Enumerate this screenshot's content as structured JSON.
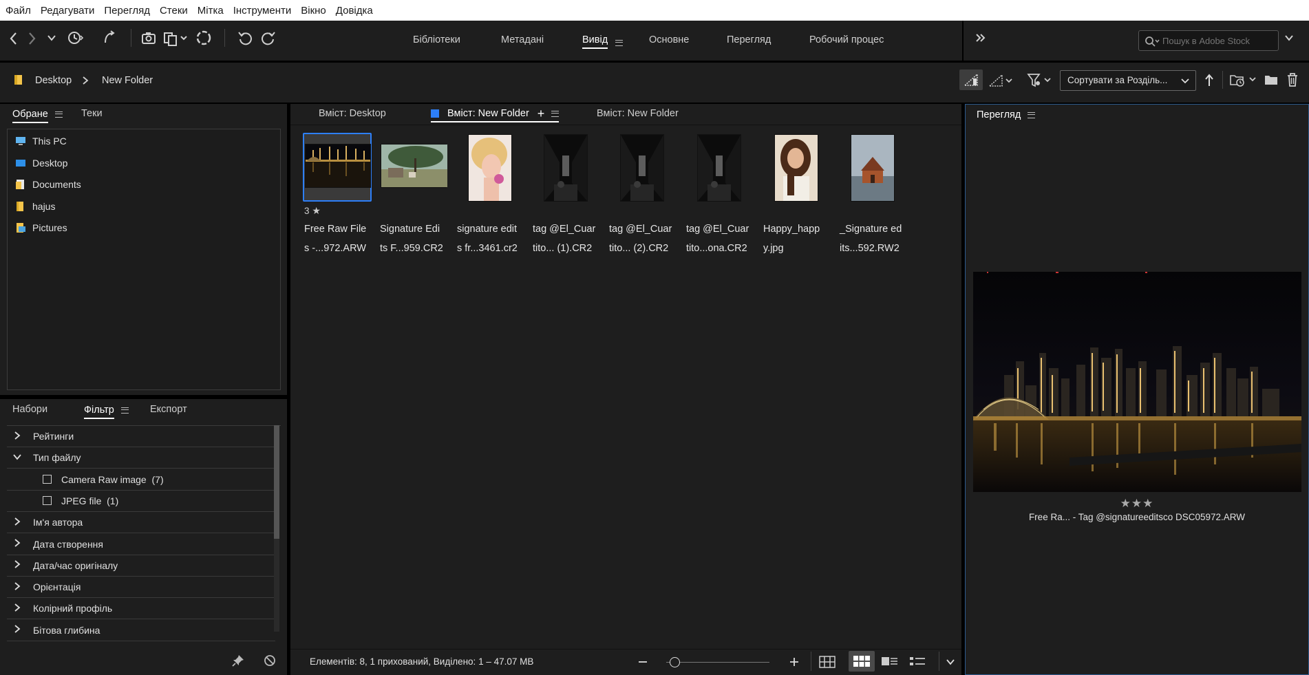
{
  "menu": [
    "Файл",
    "Редагувати",
    "Перегляд",
    "Стеки",
    "Мітка",
    "Інструменти",
    "Вікно",
    "Довідка"
  ],
  "workspaces": [
    {
      "label": "Бібліотеки",
      "active": false
    },
    {
      "label": "Метадані",
      "active": false
    },
    {
      "label": "Вивід",
      "active": true
    },
    {
      "label": "Основне",
      "active": false
    },
    {
      "label": "Перегляд",
      "active": false
    },
    {
      "label": "Робочий процес",
      "active": false
    }
  ],
  "search": {
    "placeholder": "Пошук в Adobe Stock"
  },
  "breadcrumb": {
    "root": "Desktop",
    "current": "New Folder"
  },
  "sort": {
    "label": "Сортувати за Розділь..."
  },
  "left_tabs": {
    "favorites": "Обране",
    "folders": "Теки"
  },
  "favorites": [
    {
      "label": "This PC",
      "icon": "pc-icon"
    },
    {
      "label": "Desktop",
      "icon": "desktop-icon"
    },
    {
      "label": "Documents",
      "icon": "documents-icon"
    },
    {
      "label": "hajus",
      "icon": "folder-icon"
    },
    {
      "label": "Pictures",
      "icon": "pictures-icon"
    }
  ],
  "bottom_tabs": {
    "collections": "Набори",
    "filter": "Фільтр",
    "export": "Експорт"
  },
  "filter_rows": [
    {
      "label": "Рейтинги",
      "type": "group",
      "expanded": false
    },
    {
      "label": "Тип файлу",
      "type": "group",
      "expanded": true
    },
    {
      "label": "Camera Raw image  (7)",
      "type": "option"
    },
    {
      "label": "JPEG file  (1)",
      "type": "option"
    },
    {
      "label": "Ім'я автора",
      "type": "group",
      "expanded": false
    },
    {
      "label": "Дата створення",
      "type": "group",
      "expanded": false
    },
    {
      "label": "Дата/час оригіналу",
      "type": "group",
      "expanded": false
    },
    {
      "label": "Орієнтація",
      "type": "group",
      "expanded": false
    },
    {
      "label": "Колірний профіль",
      "type": "group",
      "expanded": false
    },
    {
      "label": "Бітова глибина",
      "type": "group",
      "expanded": false
    }
  ],
  "content_tabs": [
    {
      "label": "Вміст: Desktop"
    },
    {
      "label": "Вміст: New Folder",
      "active": true
    },
    {
      "label": "Вміст: New Folder"
    }
  ],
  "thumbnails": [
    {
      "line1": "Free Raw File",
      "line2": "s -...972.ARW",
      "rating": "3",
      "selected": true,
      "kind": "night"
    },
    {
      "line1": "Signature Edi",
      "line2": "ts F...959.CR2",
      "kind": "landscape"
    },
    {
      "line1": "signature edit",
      "line2": "s fr...3461.cr2",
      "kind": "portrait-blonde"
    },
    {
      "line1": "tag @El_Cuar",
      "line2": "tito... (1).CR2",
      "kind": "alley"
    },
    {
      "line1": "tag @El_Cuar",
      "line2": "tito... (2).CR2",
      "kind": "alley"
    },
    {
      "line1": "tag @El_Cuar",
      "line2": "tito...ona.CR2",
      "kind": "alley"
    },
    {
      "line1": "Happy_happ",
      "line2": "y.jpg",
      "kind": "portrait-woman"
    },
    {
      "line1": "_Signature ed",
      "line2": "its...592.RW2",
      "kind": "house"
    }
  ],
  "status": {
    "text": "Елементів: 8, 1 прихований, Виділено: 1 – 47.07 MB"
  },
  "preview": {
    "title": "Перегляд",
    "caption": "Free Ra... - Tag @signatureeditsco DSC05972.ARW",
    "stars": "★★★"
  },
  "colors": {
    "accent": "#2d7ff9",
    "panel": "#1e1e1e",
    "background": "#000000"
  }
}
